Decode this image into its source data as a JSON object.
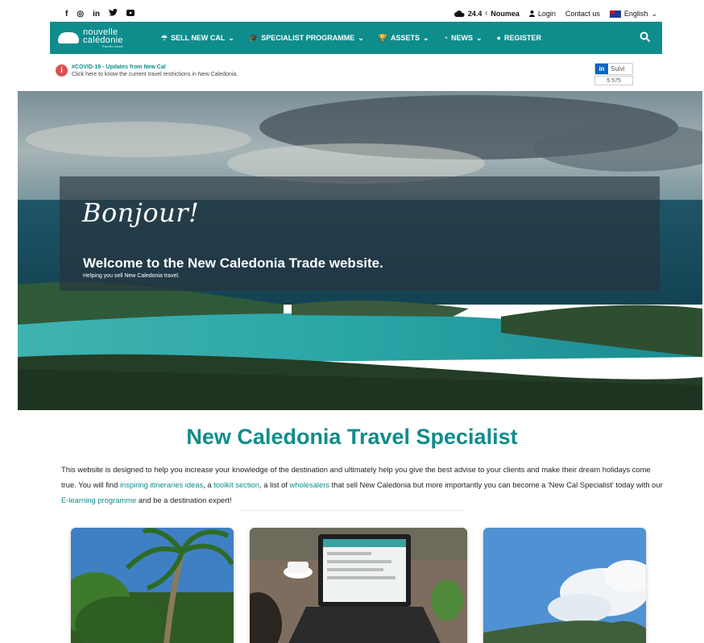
{
  "topbar": {
    "social": [
      "f",
      "◎",
      "in",
      "🐦",
      "▶"
    ],
    "weather_temp": "24.4",
    "weather_unit": "c",
    "weather_city": "Noumea",
    "login": "Login",
    "contact": "Contact us",
    "language": "English"
  },
  "nav": {
    "logo_line1": "nouvelle",
    "logo_line2": "calédonie",
    "logo_tag": "Pacific heart",
    "items": [
      {
        "label": "SELL NEW CAL",
        "icon": "umbrella-icon",
        "dropdown": true
      },
      {
        "label": "SPECIALIST PROGRAMME",
        "icon": "graduation-cap-icon",
        "dropdown": true
      },
      {
        "label": "ASSETS",
        "icon": "trophy-icon",
        "dropdown": true
      },
      {
        "label": "NEWS",
        "icon": "rss-icon",
        "dropdown": true
      },
      {
        "label": "REGISTER",
        "icon": "user-icon",
        "dropdown": false
      }
    ]
  },
  "banner": {
    "title": "#COVID-19 - Updates from New Cal",
    "text": "Click here to know the current travel restrictions in New Caledonia.",
    "linkedin_label": "Suivi",
    "linkedin_count": "5 575"
  },
  "hero": {
    "script": "Bonjour!",
    "headline": "Welcome to the New Caledonia Trade website.",
    "sub": "Helping you sell New Caledonia travel."
  },
  "intro": {
    "title": "New Caledonia Travel Specialist",
    "t1": "This website is designed to help you increase your knowledge of the destination and ultimately help you give the best advise to your clients and make their dream holidays come true. You will find ",
    "l1": "inspiring itineraries ideas",
    "t2": ", a ",
    "l2": "toolkit section",
    "t3": ", a list of ",
    "l3": "wholesalers",
    "t4": " that sell New Caledonia but more importantly you can become a 'New Cal Specialist' today with our ",
    "l4": "E-learning programme",
    "t5": " and be a destination expert!"
  },
  "colors": {
    "brand": "#0f8c8c",
    "alert": "#d9534f"
  }
}
